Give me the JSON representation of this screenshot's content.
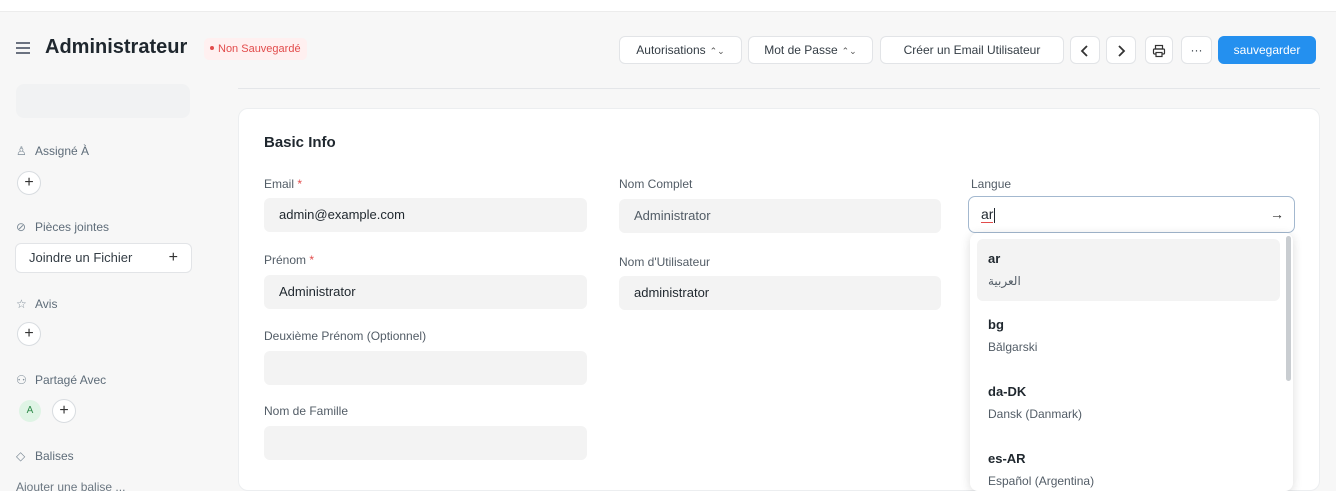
{
  "header": {
    "title": "Administrateur",
    "status": "Non Sauvegardé",
    "buttons": {
      "autorisations": "Autorisations",
      "mot_de_passe": "Mot de Passe",
      "creer_email": "Créer un Email Utilisateur",
      "save": "sauvegarder",
      "more": "···"
    }
  },
  "sidebar": {
    "assigne": "Assigné À",
    "pieces_jointes": "Pièces jointes",
    "joindre_fichier": "Joindre un Fichier",
    "avis": "Avis",
    "partage": "Partagé Avec",
    "avatar_initial": "A",
    "balises": "Balises",
    "ajouter_balise": "Ajouter une balise ..."
  },
  "form": {
    "section_title": "Basic Info",
    "email_label": "Email",
    "email_value": "admin@example.com",
    "prenom_label": "Prénom",
    "prenom_value": "Administrator",
    "deuxieme_prenom_label": "Deuxième Prénom (Optionnel)",
    "deuxieme_prenom_value": "",
    "nom_famille_label": "Nom de Famille",
    "nom_famille_value": "",
    "nom_complet_label": "Nom Complet",
    "nom_complet_value": "Administrator",
    "nom_utilisateur_label": "Nom d'Utilisateur",
    "nom_utilisateur_value": "administrator",
    "langue_label": "Langue",
    "langue_value": "ar",
    "required_mark": "*"
  },
  "language_options": [
    {
      "code": "ar",
      "name": "العربية"
    },
    {
      "code": "bg",
      "name": "Bǎlgarski"
    },
    {
      "code": "da-DK",
      "name": "Dansk (Danmark)"
    },
    {
      "code": "es-AR",
      "name": "Español (Argentina)"
    }
  ],
  "colors": {
    "accent": "#2490ef",
    "required": "#e24c4c"
  }
}
